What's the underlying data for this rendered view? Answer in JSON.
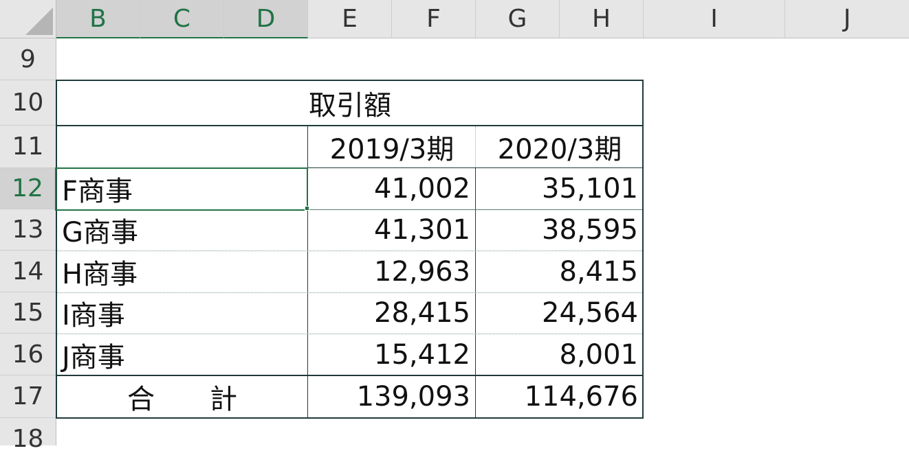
{
  "columns": [
    "B",
    "C",
    "D",
    "E",
    "F",
    "G",
    "H",
    "I",
    "J"
  ],
  "rows": [
    "9",
    "10",
    "11",
    "12",
    "13",
    "14",
    "15",
    "16",
    "17",
    "18"
  ],
  "table": {
    "title": "取引額",
    "period_headers": [
      "2019/3期",
      "2020/3期"
    ],
    "entries": [
      {
        "name": "F商事",
        "v2019": "41,002",
        "v2020": "35,101"
      },
      {
        "name": "G商事",
        "v2019": "41,301",
        "v2020": "38,595"
      },
      {
        "name": "H商事",
        "v2019": "12,963",
        "v2020": "8,415"
      },
      {
        "name": "I商事",
        "v2019": "28,415",
        "v2020": "24,564"
      },
      {
        "name": "J商事",
        "v2019": "15,412",
        "v2020": "8,001"
      }
    ],
    "total": {
      "label": "合　　計",
      "v2019": "139,093",
      "v2020": "114,676"
    }
  },
  "selection": {
    "cell": "B12",
    "column_letters": [
      "B",
      "C",
      "D"
    ],
    "row_number": "12"
  }
}
